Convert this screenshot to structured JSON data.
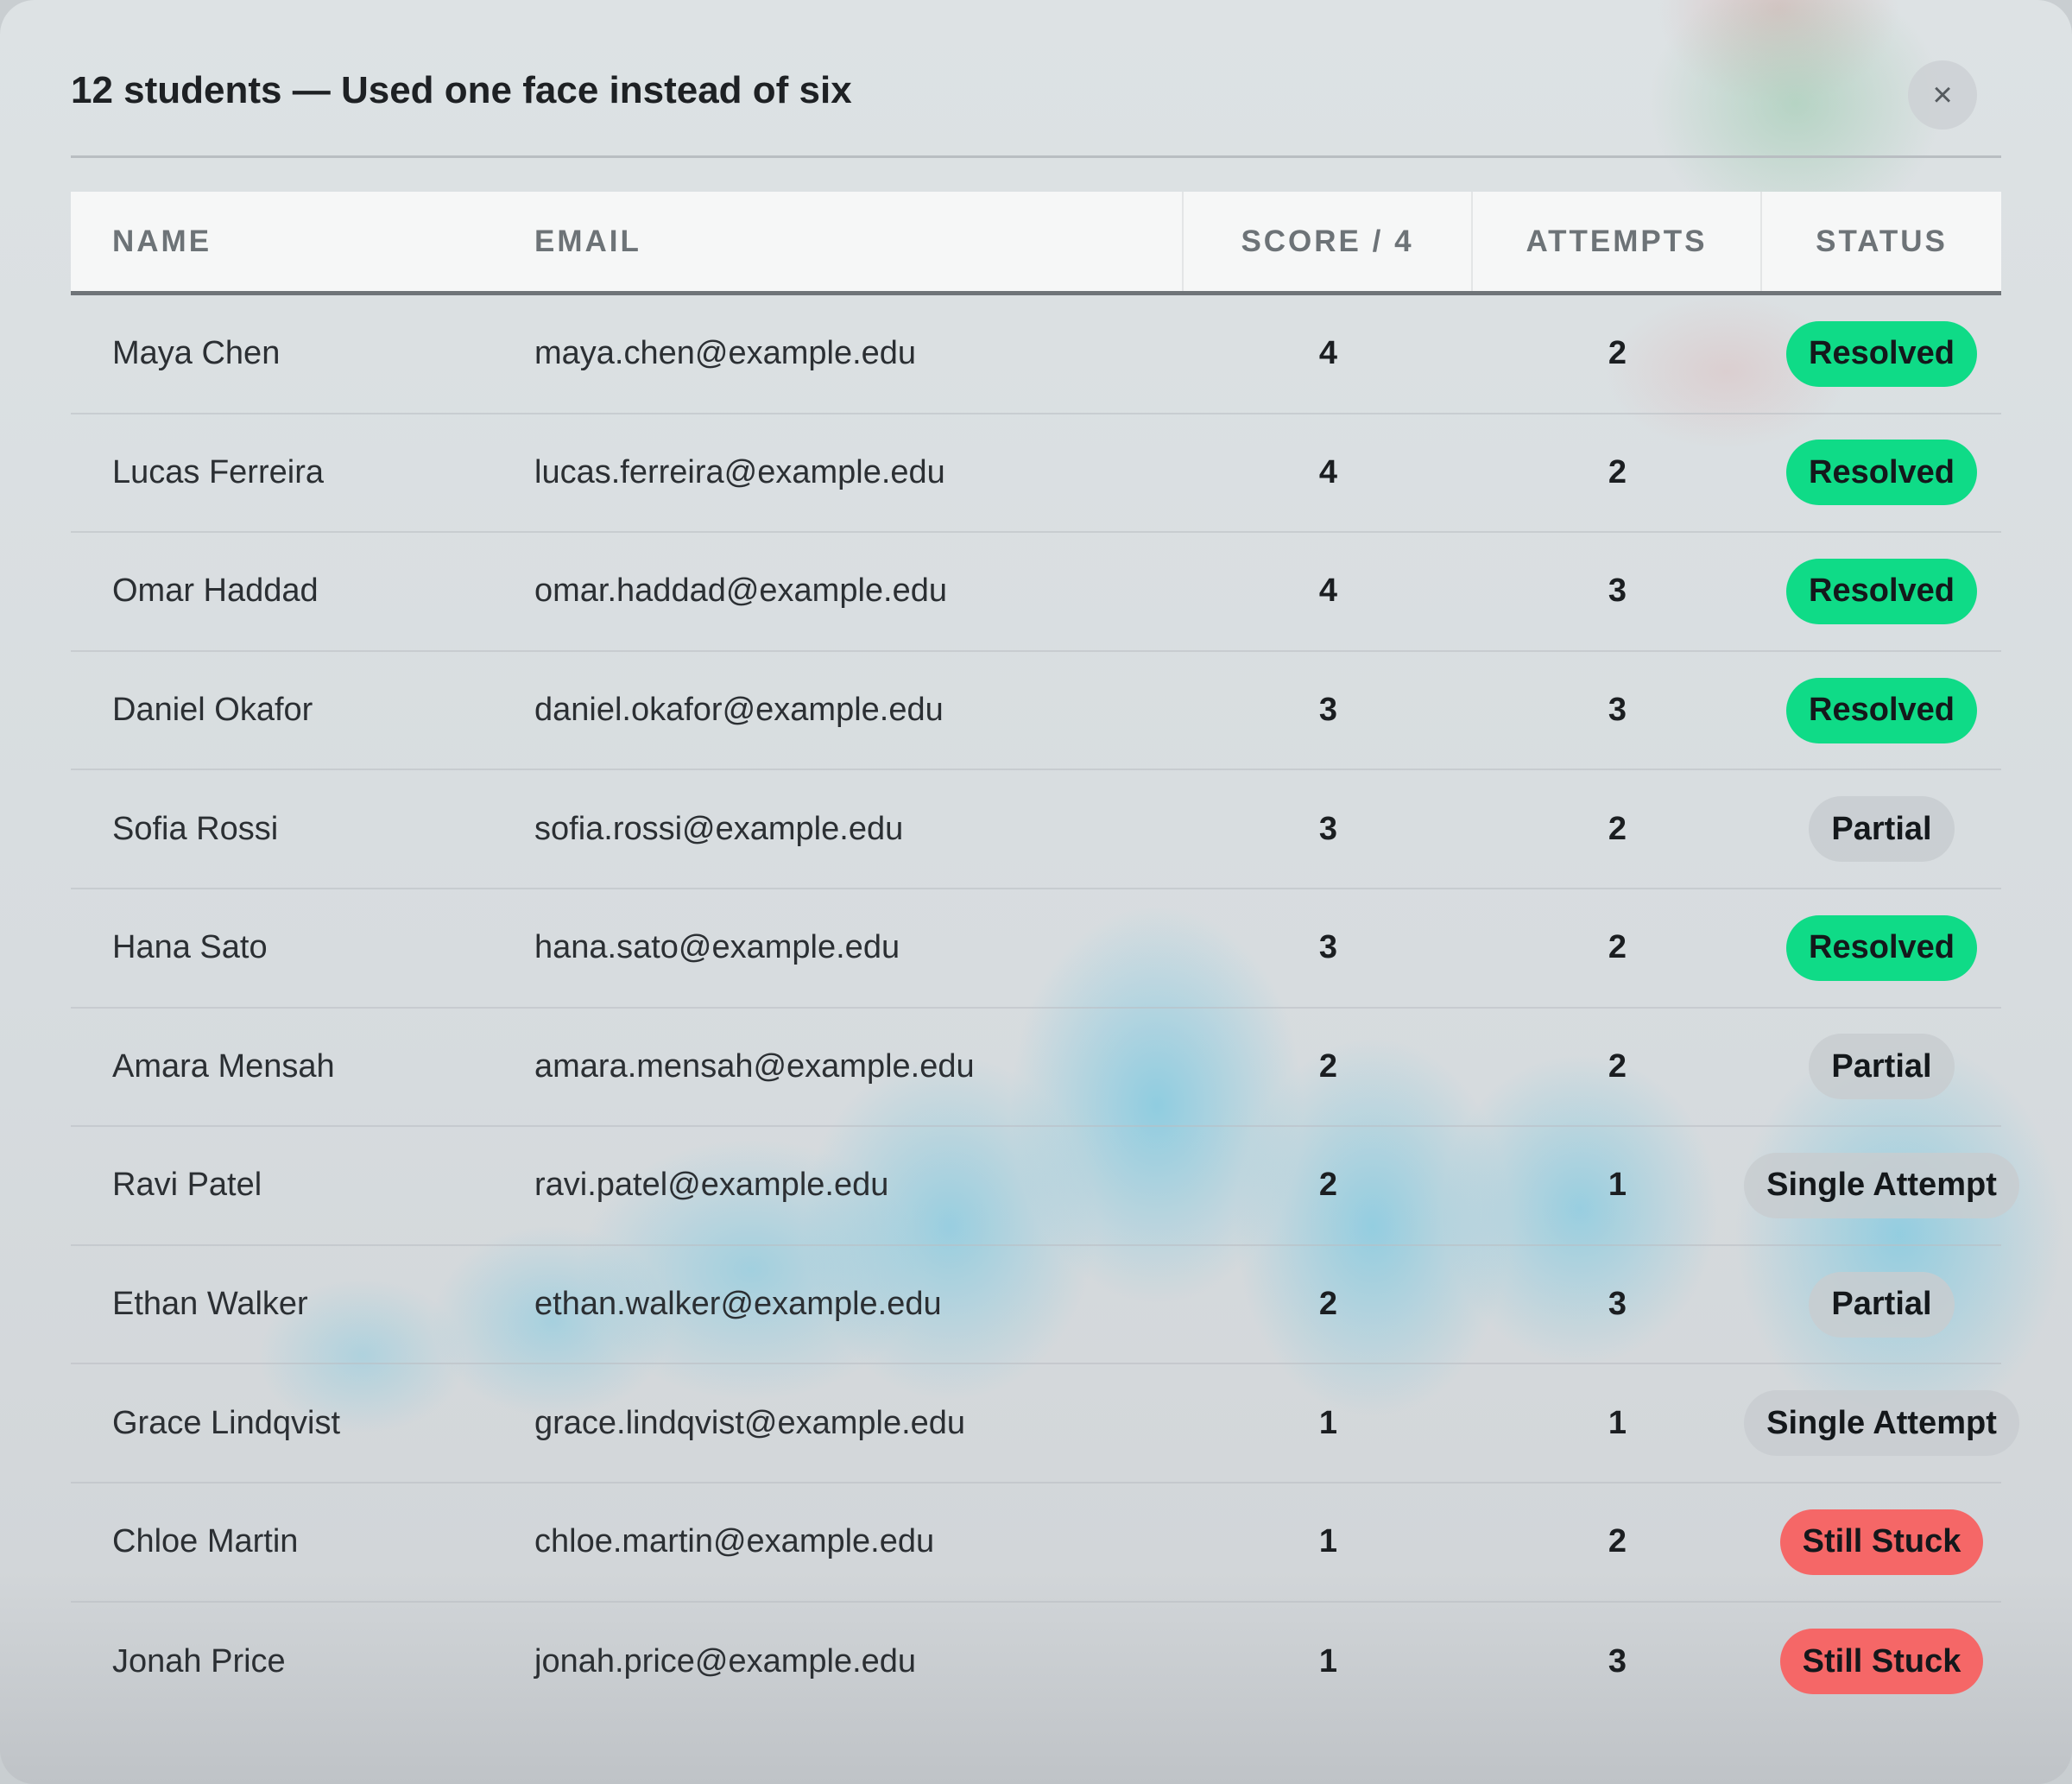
{
  "dialog": {
    "title": "12 students — Used one face instead of six",
    "close_glyph": "×",
    "close_icon": "close-icon"
  },
  "table": {
    "columns": [
      "NAME",
      "EMAIL",
      "SCORE / 4",
      "ATTEMPTS",
      "STATUS"
    ],
    "rows": [
      {
        "name": "Maya Chen",
        "email": "maya.chen@example.edu",
        "score": "4",
        "attempts": "2",
        "status": "Resolved",
        "status_kind": "resolved"
      },
      {
        "name": "Lucas Ferreira",
        "email": "lucas.ferreira@example.edu",
        "score": "4",
        "attempts": "2",
        "status": "Resolved",
        "status_kind": "resolved"
      },
      {
        "name": "Omar Haddad",
        "email": "omar.haddad@example.edu",
        "score": "4",
        "attempts": "3",
        "status": "Resolved",
        "status_kind": "resolved"
      },
      {
        "name": "Daniel Okafor",
        "email": "daniel.okafor@example.edu",
        "score": "3",
        "attempts": "3",
        "status": "Resolved",
        "status_kind": "resolved"
      },
      {
        "name": "Sofia Rossi",
        "email": "sofia.rossi@example.edu",
        "score": "3",
        "attempts": "2",
        "status": "Partial",
        "status_kind": "partial"
      },
      {
        "name": "Hana Sato",
        "email": "hana.sato@example.edu",
        "score": "3",
        "attempts": "2",
        "status": "Resolved",
        "status_kind": "resolved"
      },
      {
        "name": "Amara Mensah",
        "email": "amara.mensah@example.edu",
        "score": "2",
        "attempts": "2",
        "status": "Partial",
        "status_kind": "partial"
      },
      {
        "name": "Ravi Patel",
        "email": "ravi.patel@example.edu",
        "score": "2",
        "attempts": "1",
        "status": "Single Attempt",
        "status_kind": "single"
      },
      {
        "name": "Ethan Walker",
        "email": "ethan.walker@example.edu",
        "score": "2",
        "attempts": "3",
        "status": "Partial",
        "status_kind": "partial"
      },
      {
        "name": "Grace Lindqvist",
        "email": "grace.lindqvist@example.edu",
        "score": "1",
        "attempts": "1",
        "status": "Single Attempt",
        "status_kind": "single"
      },
      {
        "name": "Chloe Martin",
        "email": "chloe.martin@example.edu",
        "score": "1",
        "attempts": "2",
        "status": "Still Stuck",
        "status_kind": "stuck"
      },
      {
        "name": "Jonah Price",
        "email": "jonah.price@example.edu",
        "score": "1",
        "attempts": "3",
        "status": "Still Stuck",
        "status_kind": "stuck"
      }
    ]
  },
  "colors": {
    "resolved": "#0fdb87",
    "partial": "#c8cdd0",
    "single_attempt": "#c8cdd0",
    "still_stuck": "#f56767"
  }
}
